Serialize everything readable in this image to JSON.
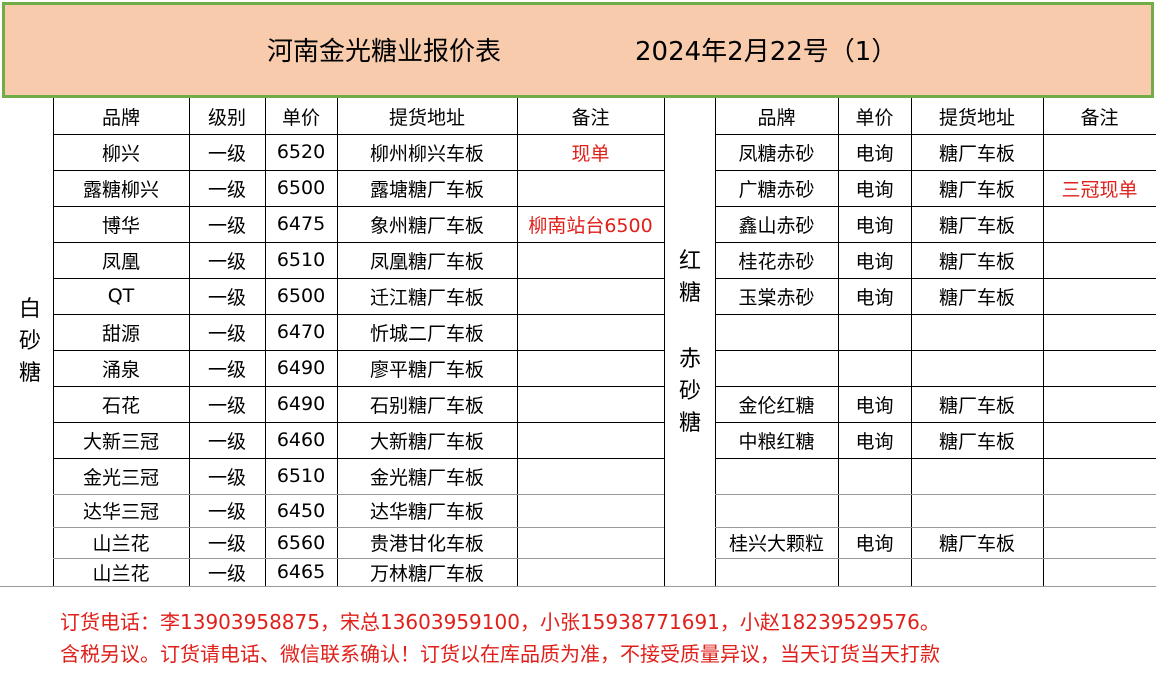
{
  "header": {
    "title": "河南金光糖业报价表",
    "date": "2024年2月22号（1）"
  },
  "white_sugar": {
    "category_label": [
      "白",
      "砂",
      "糖"
    ],
    "columns": [
      "品牌",
      "级别",
      "单价",
      "提货地址",
      "备注"
    ],
    "rows": [
      [
        "柳兴",
        "一级",
        "6520",
        "柳州柳兴车板",
        "现单"
      ],
      [
        "露糖柳兴",
        "一级",
        "6500",
        "露塘糖厂车板",
        ""
      ],
      [
        "博华",
        "一级",
        "6475",
        "象州糖厂车板",
        "柳南站台6500"
      ],
      [
        "凤凰",
        "一级",
        "6510",
        "凤凰糖厂车板",
        ""
      ],
      [
        "QT",
        "一级",
        "6500",
        "迁江糖厂车板",
        ""
      ],
      [
        "甜源",
        "一级",
        "6470",
        "忻城二厂车板",
        ""
      ],
      [
        "涌泉",
        "一级",
        "6490",
        "廖平糖厂车板",
        ""
      ],
      [
        "石花",
        "一级",
        "6490",
        "石别糖厂车板",
        ""
      ],
      [
        "大新三冠",
        "一级",
        "6460",
        "大新糖厂车板",
        ""
      ],
      [
        "金光三冠",
        "一级",
        "6510",
        "金光糖厂车板",
        ""
      ],
      [
        "达华三冠",
        "一级",
        "6450",
        "达华糖厂车板",
        ""
      ],
      [
        "山兰花",
        "一级",
        "6560",
        "贵港甘化车板",
        ""
      ],
      [
        "山兰花",
        "一级",
        "6465",
        "万林糖厂车板",
        ""
      ]
    ]
  },
  "red_sugar": {
    "category_label_top": [
      "红",
      "糖"
    ],
    "category_label_bottom": [
      "赤",
      "砂",
      "糖"
    ],
    "columns": [
      "品牌",
      "单价",
      "提货地址",
      "备注"
    ],
    "rows": [
      [
        "凤糖赤砂",
        "电询",
        "糖厂车板",
        ""
      ],
      [
        "广糖赤砂",
        "电询",
        "糖厂车板",
        "三冠现单"
      ],
      [
        "鑫山赤砂",
        "电询",
        "糖厂车板",
        ""
      ],
      [
        "桂花赤砂",
        "电询",
        "糖厂车板",
        ""
      ],
      [
        "玉棠赤砂",
        "电询",
        "糖厂车板",
        ""
      ],
      [
        "",
        "",
        "",
        ""
      ],
      [
        "",
        "",
        "",
        ""
      ],
      [
        "金伦红糖",
        "电询",
        "糖厂车板",
        ""
      ],
      [
        "中粮红糖",
        "电询",
        "糖厂车板",
        ""
      ],
      [
        "",
        "",
        "",
        ""
      ],
      [
        "",
        "",
        "",
        ""
      ],
      [
        "桂兴大颗粒",
        "电询",
        "糖厂车板",
        ""
      ],
      [
        "",
        "",
        "",
        ""
      ]
    ]
  },
  "footer": {
    "phones": "订货电话：李13903958875，宋总13603959100，小张15938771691，小赵18239529576。",
    "notice": "含税另议。订货请电话、微信联系确认！订货以在库品质为准，不接受质量异议，当天订货当天打款"
  },
  "colors": {
    "header_bg": "#f8cbad",
    "header_border": "#70ad47",
    "remark_red": "#e0201b"
  }
}
